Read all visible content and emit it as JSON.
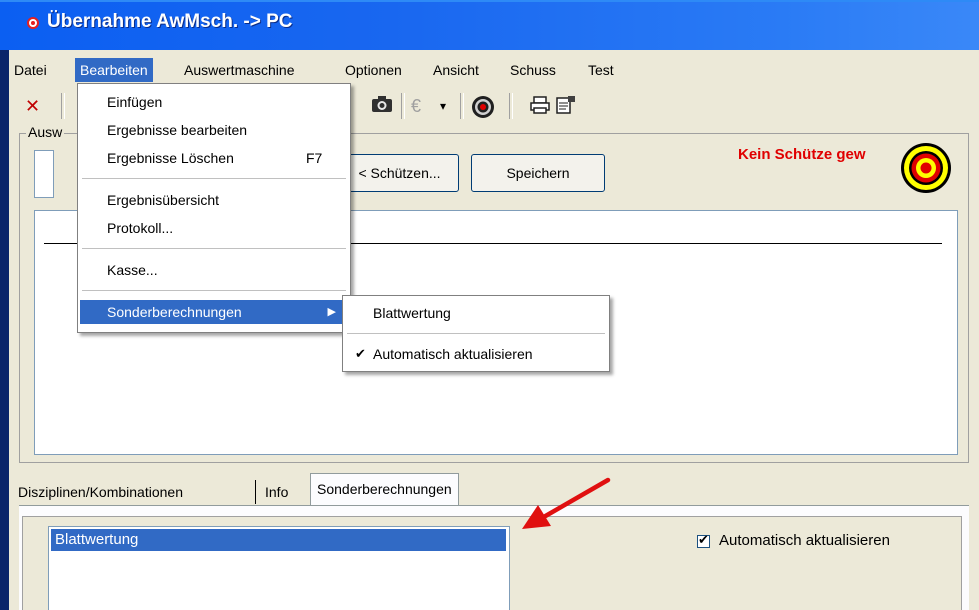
{
  "window": {
    "title": "Übernahme AwMsch. -> PC"
  },
  "menubar": {
    "items": [
      "Datei",
      "Bearbeiten",
      "Auswertmaschine",
      "Optionen",
      "Ansicht",
      "Schuss",
      "Test"
    ],
    "active": "Bearbeiten"
  },
  "toolbar": {
    "icons": [
      "close-icon",
      "camera-icon",
      "euro-icon",
      "target-icon",
      "printer-icon",
      "properties-icon"
    ],
    "close_glyph": "✕",
    "euro_glyph": "€",
    "dropdown_glyph": "▾"
  },
  "main": {
    "group_label": "Ausw",
    "schuetzen_button": "< Schützen...",
    "speichern_button": "Speichern",
    "status_text": "Kein Schütze gew",
    "colors": {
      "status": "#e00000",
      "selection": "#316ac5"
    }
  },
  "tabs": {
    "items": [
      "Disziplinen/Kombinationen",
      "Info",
      "Sonderberechnungen"
    ],
    "selected": "Sonderberechnungen"
  },
  "sonder_panel": {
    "list_items": [
      "Blattwertung"
    ],
    "selected_item": "Blattwertung",
    "auto_update_label": "Automatisch aktualisieren",
    "auto_update_checked": true
  },
  "bearbeiten_menu": {
    "items": [
      {
        "label": "Einfügen",
        "shortcut": ""
      },
      {
        "label": "Ergebnisse bearbeiten",
        "shortcut": ""
      },
      {
        "label": "Ergebnisse Löschen",
        "shortcut": "F7"
      },
      {
        "label": "Ergebnisübersicht",
        "shortcut": ""
      },
      {
        "label": "Protokoll...",
        "shortcut": ""
      },
      {
        "label": "Kasse...",
        "shortcut": ""
      },
      {
        "label": "Sonderberechnungen",
        "shortcut": ""
      }
    ],
    "highlighted": "Sonderberechnungen",
    "submenu_arrow": "▶"
  },
  "sonder_submenu": {
    "items": [
      {
        "label": "Blattwertung",
        "checked": false
      },
      {
        "label": "Automatisch aktualisieren",
        "checked": true
      }
    ],
    "check_glyph": "✔"
  }
}
